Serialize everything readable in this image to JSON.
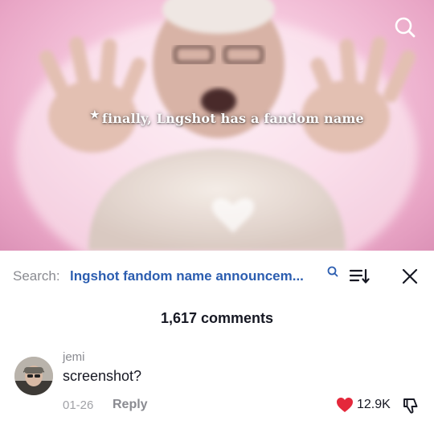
{
  "video": {
    "caption": "finally, Lngshot has a fandom name",
    "caption_star": "★",
    "search_icon": "search-icon"
  },
  "comments_panel": {
    "search_label": "Search:",
    "search_query": "lngshot fandom name announcem...",
    "search_suggest_icon": "search-icon",
    "sort_icon": "sort-icon",
    "close_icon": "close-icon",
    "count_label": "1,617 comments"
  },
  "comment": {
    "username": "jemi",
    "text": "screenshot?",
    "date": "01-26",
    "reply_label": "Reply",
    "like_count": "12.9K",
    "liked": true,
    "like_icon": "heart-icon",
    "dislike_icon": "dislike-icon"
  },
  "colors": {
    "link_blue": "#2b5db0",
    "like_red": "#e4283b",
    "muted_gray": "#8a8b91",
    "text_dark": "#161823"
  }
}
